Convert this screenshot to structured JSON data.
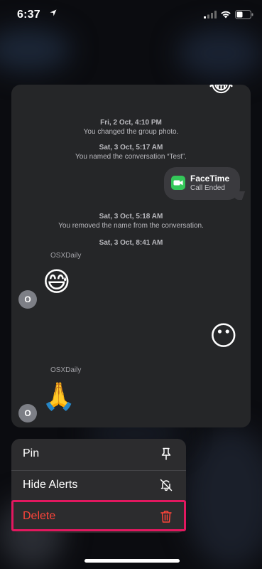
{
  "status": {
    "time": "6:37"
  },
  "conversation": {
    "events": [
      {
        "date": "Fri, 2 Oct, 4:10 PM",
        "text": "You changed the group photo."
      },
      {
        "date": "Sat, 3 Oct, 5:17 AM",
        "text": "You named the conversation “Test”."
      },
      {
        "date": "Sat, 3 Oct, 5:18 AM",
        "text": "You removed the name from the conversation."
      },
      {
        "date": "Sat, 3 Oct, 8:41 AM",
        "text": ""
      }
    ],
    "facetime": {
      "title": "FaceTime",
      "subtitle": "Call Ended"
    },
    "messages": [
      {
        "sender": "OSXDaily",
        "avatar": "O",
        "emoji": "😅"
      },
      {
        "emoji": "😶"
      },
      {
        "sender": "OSXDaily",
        "avatar": "O",
        "emoji": "🙏"
      }
    ],
    "top_emoji": "😂"
  },
  "menu": {
    "items": [
      {
        "label": "Pin",
        "icon": "pin-icon"
      },
      {
        "label": "Hide Alerts",
        "icon": "bell-slash-icon"
      },
      {
        "label": "Delete",
        "icon": "trash-icon",
        "destructive": true
      }
    ]
  },
  "colors": {
    "accent_delete": "#ff453a",
    "facetime_green": "#34c759",
    "highlight": "#e2185f"
  }
}
